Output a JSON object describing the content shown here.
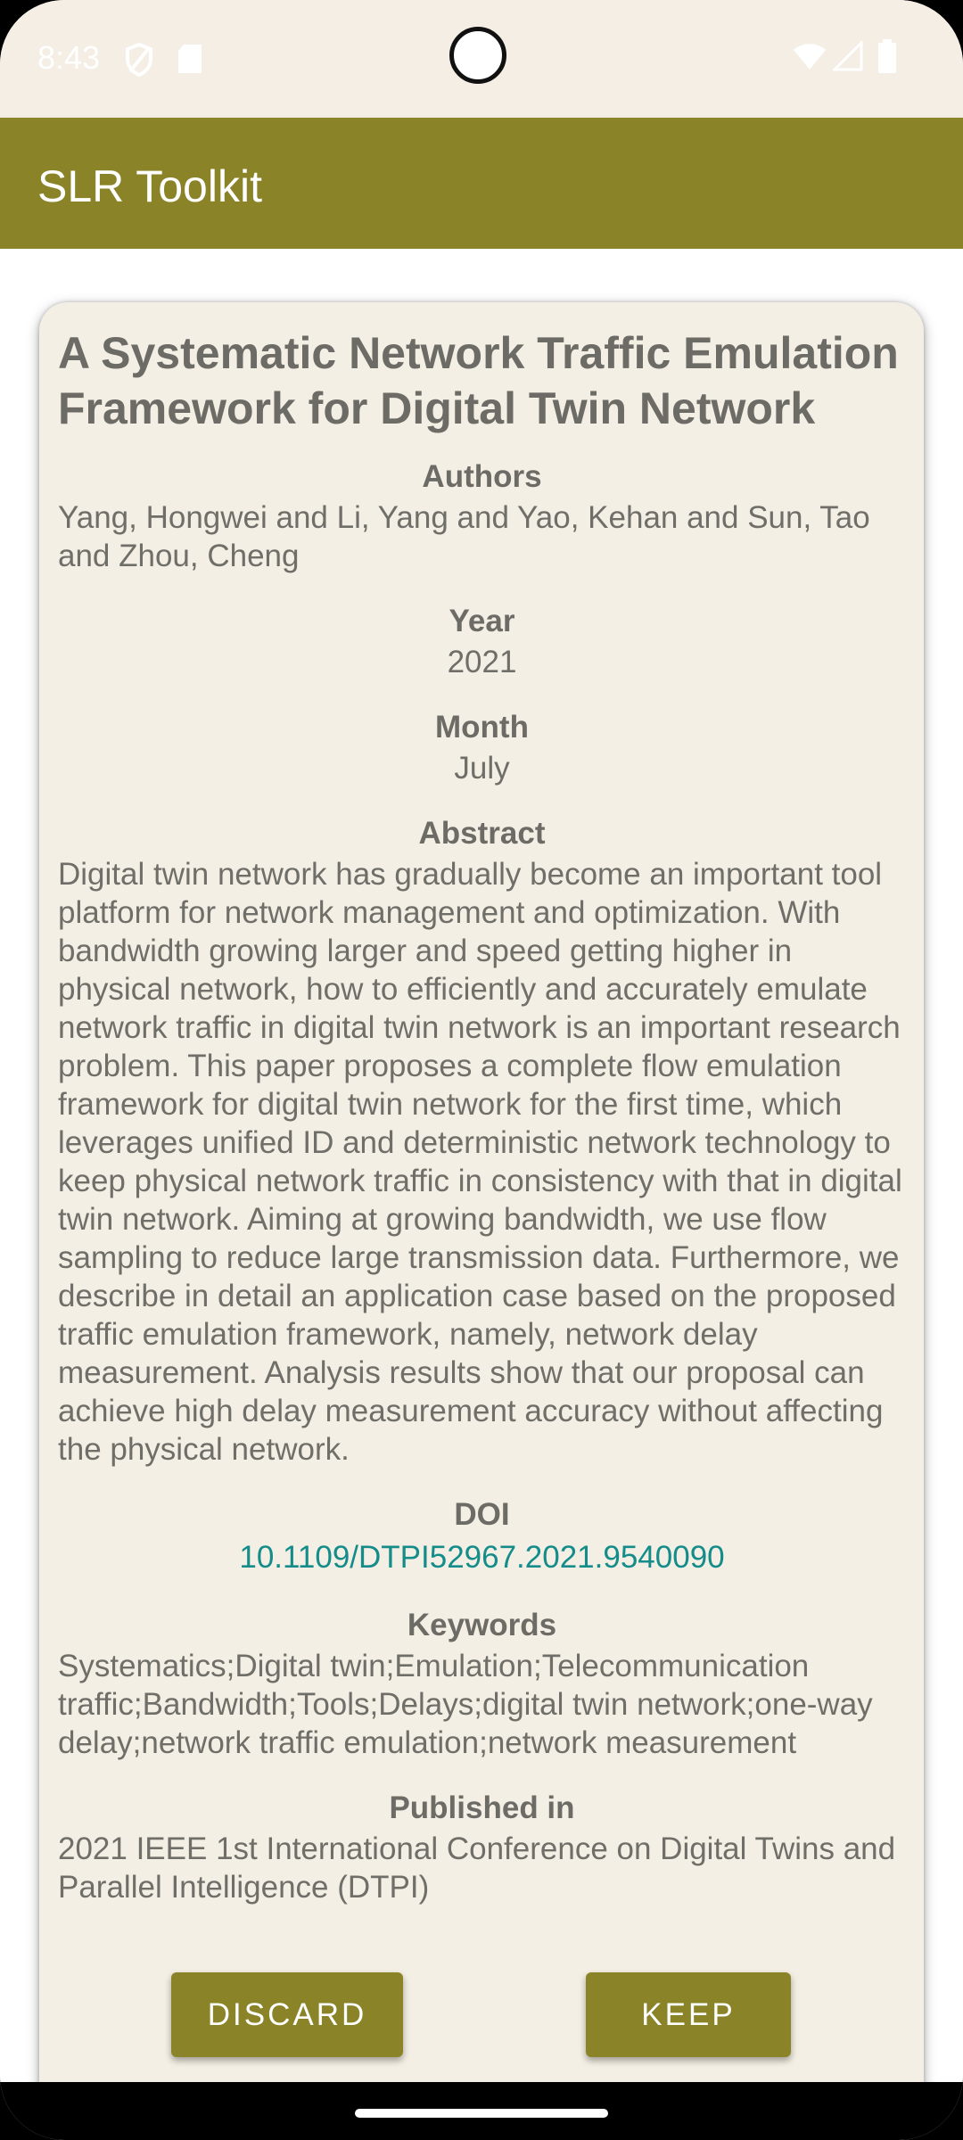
{
  "status_bar": {
    "time": "8:43",
    "icons_left": [
      "shield-icon",
      "sd-card-icon"
    ],
    "icons_right": [
      "wifi-icon",
      "cellular-signal-icon",
      "battery-icon"
    ]
  },
  "app_bar": {
    "title": "SLR Toolkit",
    "color": "#8a8327"
  },
  "paper": {
    "title": "A Systematic Network Traffic Emulation Framework for Digital Twin Network",
    "authors_label": "Authors",
    "authors": "Yang, Hongwei and Li, Yang and Yao, Kehan and Sun, Tao and Zhou, Cheng",
    "year_label": "Year",
    "year": "2021",
    "month_label": "Month",
    "month": "July",
    "abstract_label": "Abstract",
    "abstract": "Digital twin network has gradually become an important tool platform for network management and optimization. With bandwidth growing larger and speed getting higher in physical network, how to efficiently and accurately emulate network traffic in digital twin network is an important research problem. This paper proposes a complete flow emulation framework for digital twin network for the first time, which leverages unified ID and deterministic network technology to keep physical network traffic in consistency with that in digital twin network. Aiming at growing bandwidth, we use flow sampling to reduce large transmission data. Furthermore, we describe in detail an application case based on the proposed traffic emulation framework, namely, network delay measurement. Analysis results show that our proposal can achieve high delay measurement accuracy without affecting the physical network.",
    "doi_label": "DOI",
    "doi": "10.1109/DTPI52967.2021.9540090",
    "keywords_label": "Keywords",
    "keywords": "Systematics;Digital twin;Emulation;Telecommunication traffic;Bandwidth;Tools;Delays;digital twin network;one-way delay;network traffic emulation;network measurement",
    "published_label": "Published in",
    "published": "2021 IEEE 1st International Conference on Digital Twins and Parallel Intelligence (DTPI)"
  },
  "actions": {
    "discard_label": "DISCARD",
    "keep_label": "KEEP"
  },
  "colors": {
    "accent": "#8a8327",
    "card_background": "#f4efe4",
    "text": "#6f6e68",
    "link": "#138c8a"
  }
}
